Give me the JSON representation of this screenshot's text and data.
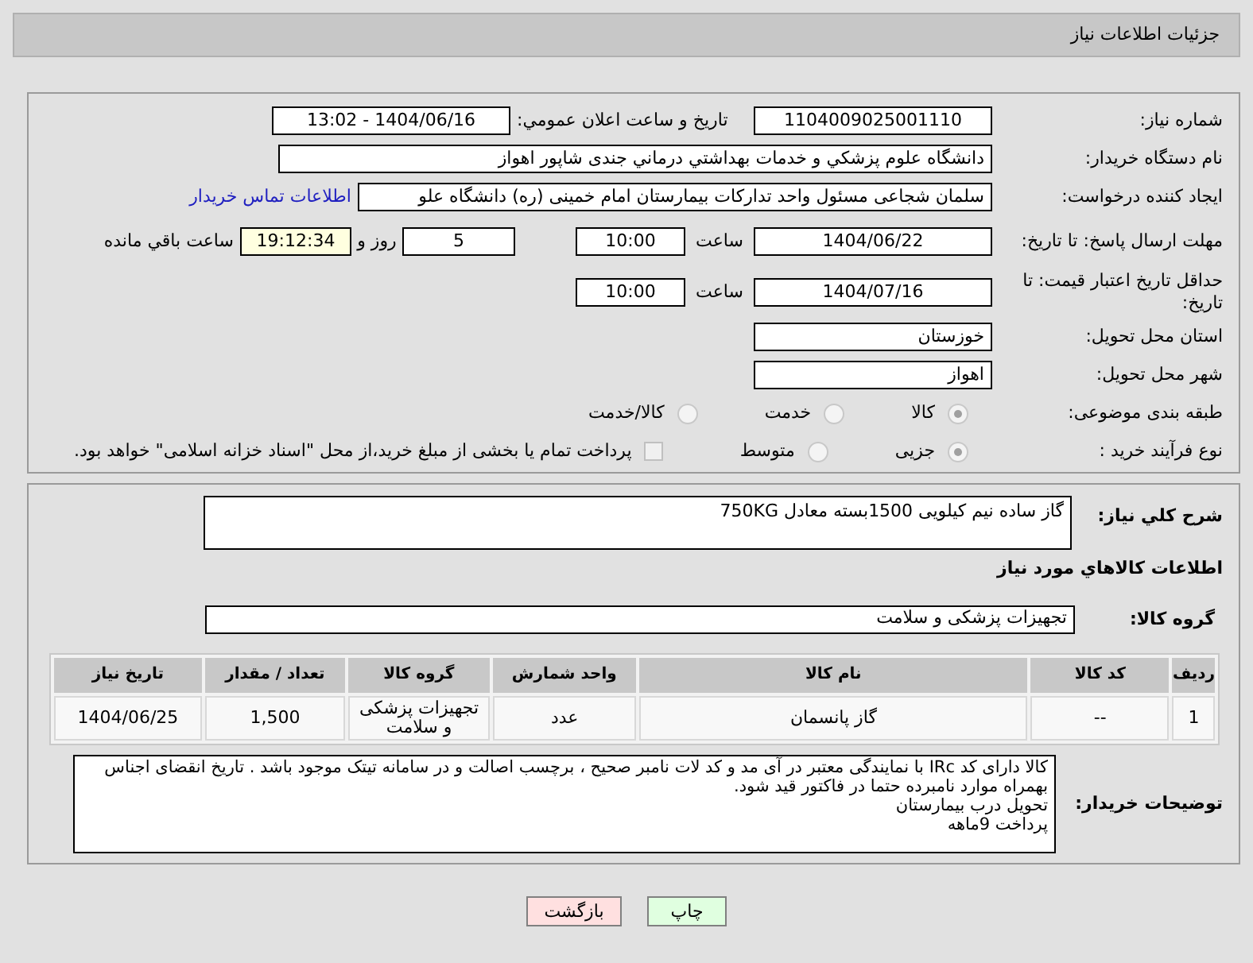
{
  "header": {
    "title": "جزئیات اطلاعات نیاز"
  },
  "need_number": {
    "label": "شماره نیاز:",
    "value": "1104009025001110"
  },
  "announce": {
    "label": "تاریخ و ساعت اعلان عمومي:",
    "value": "1404/06/16 - 13:02"
  },
  "buyer": {
    "label": "نام دستگاه خریدار:",
    "value": "دانشگاه علوم پزشکي و خدمات بهداشتي درماني جندی شاپور اهواز"
  },
  "requester": {
    "label": "ایجاد کننده درخواست:",
    "value": "سلمان شجاعی مسئول واحد تدارکات بیمارستان امام خمینی (ره) دانشگاه علو",
    "link": "اطلاعات تماس خریدار"
  },
  "deadline": {
    "label": "مهلت ارسال پاسخ: تا تاریخ:",
    "date": "1404/06/22",
    "time_label": "ساعت",
    "time": "10:00",
    "days": "5",
    "days_label": "روز و",
    "remaining": "19:12:34",
    "remaining_label": "ساعت باقي مانده"
  },
  "validity": {
    "label": "حداقل تاریخ اعتبار قیمت: تا تاریخ:",
    "date": "1404/07/16",
    "time_label": "ساعت",
    "time": "10:00"
  },
  "province": {
    "label": "استان محل تحویل:",
    "value": "خوزستان"
  },
  "city": {
    "label": "شهر محل تحویل:",
    "value": "اهواز"
  },
  "category": {
    "label": "طبقه بندی موضوعی:",
    "options": [
      {
        "label": "کالا",
        "selected": true
      },
      {
        "label": "خدمت",
        "selected": false
      },
      {
        "label": "کالا/خدمت",
        "selected": false
      }
    ]
  },
  "process": {
    "label": "نوع فرآیند خرید :",
    "options": [
      {
        "label": "جزیی",
        "selected": true
      },
      {
        "label": "متوسط",
        "selected": false
      }
    ],
    "treasury": {
      "label": "پرداخت تمام یا بخشی از مبلغ خرید،از محل \"اسناد خزانه اسلامی\" خواهد بود.",
      "checked": false
    }
  },
  "summary": {
    "label": "شرح کلي نیاز:",
    "value": "گاز ساده نیم کیلویی 1500بسته معادل 750KG"
  },
  "goods_title": "اطلاعات کالاهاي مورد نیاز",
  "goods_group": {
    "label": "گروه کالا:",
    "value": "تجهیزات پزشکی و سلامت"
  },
  "table": {
    "columns": [
      "ردیف",
      "کد کالا",
      "نام کالا",
      "واحد شمارش",
      "گروه کالا",
      "تعداد / مقدار",
      "تاریخ نیاز"
    ],
    "rows": [
      [
        "1",
        "--",
        "گاز پانسمان",
        "عدد",
        "تجهیزات پزشکی و سلامت",
        "1,500",
        "1404/06/25"
      ]
    ]
  },
  "buyer_notes": {
    "label": "توضیحات خریدار:",
    "lines": [
      "کالا دارای کد IRc با نمایندگی معتبر در آی مد و کد لات نامبر صحیح ، برچسب اصالت و در سامانه تیتک موجود باشد . تاریخ انقضای اجناس بهمراه موارد نامبرده حتما در فاکتور قید شود.",
      "تحویل درب بیمارستان",
      "پرداخت 9ماهه"
    ]
  },
  "buttons": [
    {
      "label": "چاپ",
      "kind": "print"
    },
    {
      "label": "بازگشت",
      "kind": "back"
    }
  ]
}
